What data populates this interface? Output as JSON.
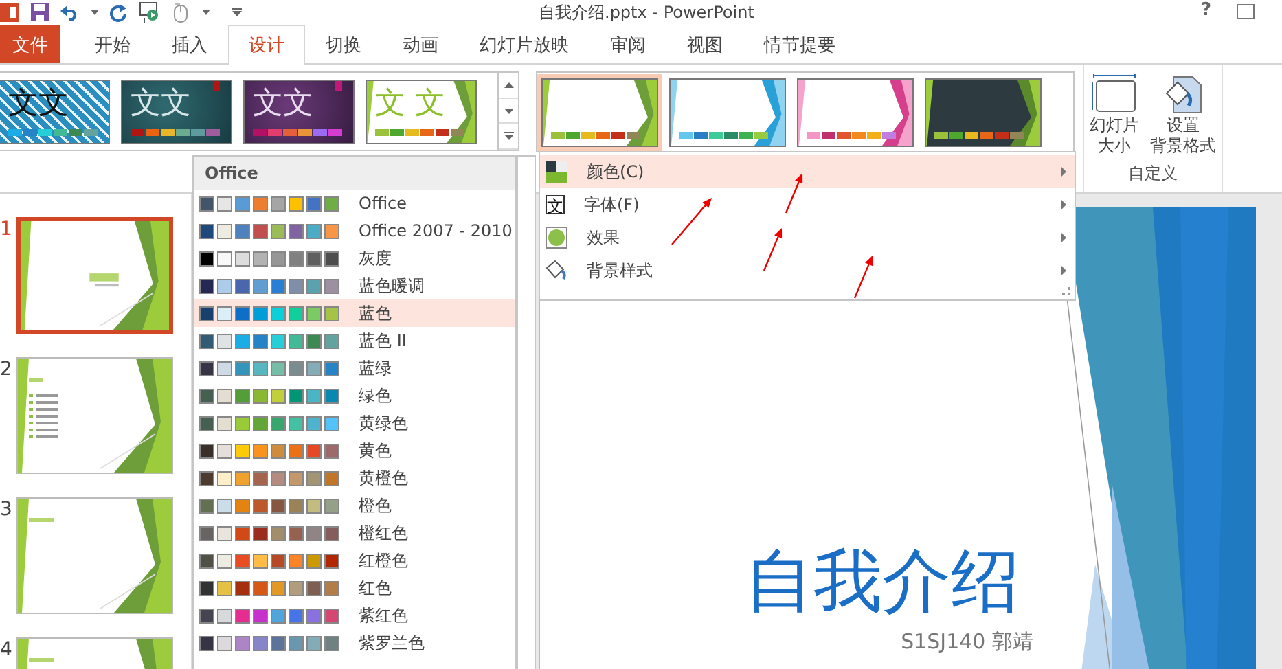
{
  "title_bar": {
    "title": "自我介绍.pptx - PowerPoint",
    "help": "?"
  },
  "tabs": [
    {
      "label": "文件",
      "kind": "file",
      "selected": false
    },
    {
      "label": "开始",
      "kind": "tab",
      "selected": false
    },
    {
      "label": "插入",
      "kind": "tab",
      "selected": false
    },
    {
      "label": "设计",
      "kind": "tab",
      "selected": true
    },
    {
      "label": "切换",
      "kind": "tab",
      "selected": false
    },
    {
      "label": "动画",
      "kind": "tab",
      "selected": false
    },
    {
      "label": "幻灯片放映",
      "kind": "tab",
      "selected": false
    },
    {
      "label": "审阅",
      "kind": "tab",
      "selected": false
    },
    {
      "label": "视图",
      "kind": "tab",
      "selected": false
    },
    {
      "label": "情节提要",
      "kind": "tab",
      "selected": false
    }
  ],
  "themes": [
    {
      "kind": "pattern",
      "sample": "文文",
      "swatches": [
        {
          "color": "#1cade4"
        },
        {
          "color": "#2683c6"
        },
        {
          "color": "#27ced7"
        },
        {
          "color": "#42ba97"
        },
        {
          "color": "#3e8853"
        },
        {
          "color": "#62a39f"
        }
      ]
    },
    {
      "kind": "teal",
      "sample": "文文",
      "swatches": [
        {
          "color": "#b01513"
        },
        {
          "color": "#ea6312"
        },
        {
          "color": "#e6b729"
        },
        {
          "color": "#6aac90"
        },
        {
          "color": "#5f9c9d"
        },
        {
          "color": "#9e5e9b"
        }
      ]
    },
    {
      "kind": "purple",
      "sample": "文文",
      "swatches": [
        {
          "color": "#b31166"
        },
        {
          "color": "#e33d6f"
        },
        {
          "color": "#e45f3c"
        },
        {
          "color": "#e9943a"
        },
        {
          "color": "#9b6bf2"
        },
        {
          "color": "#d53dd0"
        }
      ]
    },
    {
      "kind": "facet",
      "sample": "文 文",
      "swatches": [
        {
          "color": "#99c139"
        },
        {
          "color": "#4ea72e"
        },
        {
          "color": "#e6b91e"
        },
        {
          "color": "#e76618"
        },
        {
          "color": "#c42f1a"
        },
        {
          "color": "#918655"
        }
      ]
    }
  ],
  "variants": [
    {
      "kind": "green",
      "selected": true,
      "swatches": [
        {
          "color": "#99c139"
        },
        {
          "color": "#4ea72e"
        },
        {
          "color": "#e6b91e"
        },
        {
          "color": "#e76618"
        },
        {
          "color": "#c42f1a"
        },
        {
          "color": "#918655"
        }
      ]
    },
    {
      "kind": "blue",
      "selected": false,
      "swatches": [
        {
          "color": "#62c6ef"
        },
        {
          "color": "#2a7fc4"
        },
        {
          "color": "#3dcb9a"
        },
        {
          "color": "#2b8a68"
        },
        {
          "color": "#3cb250"
        },
        {
          "color": "#98cb3e"
        }
      ]
    },
    {
      "kind": "pink",
      "selected": false,
      "swatches": [
        {
          "color": "#f395c5"
        },
        {
          "color": "#c0306e"
        },
        {
          "color": "#e2532e"
        },
        {
          "color": "#f08a1d"
        },
        {
          "color": "#f1b018"
        },
        {
          "color": "#c07ee0"
        }
      ]
    },
    {
      "kind": "dark",
      "selected": false,
      "swatches": [
        {
          "color": "#99c139"
        },
        {
          "color": "#4ea72e"
        },
        {
          "color": "#e6b91e"
        },
        {
          "color": "#e76618"
        },
        {
          "color": "#c42f1a"
        },
        {
          "color": "#918655"
        }
      ]
    }
  ],
  "customize": {
    "buttons": [
      {
        "kind": "size",
        "lines": [
          "幻灯片",
          "大小"
        ]
      },
      {
        "kind": "background",
        "lines": [
          "设置",
          "背景格式"
        ]
      }
    ],
    "group_label": "自定义"
  },
  "slides": [
    {
      "number": "1",
      "selected": true,
      "kind": "title"
    },
    {
      "number": "2",
      "selected": false,
      "kind": "list"
    },
    {
      "number": "3",
      "selected": false,
      "kind": "heading"
    },
    {
      "number": "4",
      "selected": false,
      "kind": "heading"
    }
  ],
  "color_schemes": {
    "header": "Office",
    "items": [
      {
        "name": "Office",
        "selected": false,
        "swatches": [
          {
            "color": "#44546a"
          },
          {
            "color": "#e7e6e6"
          },
          {
            "color": "#5b9bd5"
          },
          {
            "color": "#ed7d31"
          },
          {
            "color": "#a5a5a5"
          },
          {
            "color": "#ffc000"
          },
          {
            "color": "#4472c4"
          },
          {
            "color": "#70ad47"
          }
        ]
      },
      {
        "name": "Office 2007 - 2010",
        "selected": false,
        "swatches": [
          {
            "color": "#1f497d"
          },
          {
            "color": "#eeece1"
          },
          {
            "color": "#4f81bd"
          },
          {
            "color": "#c0504d"
          },
          {
            "color": "#9bbb59"
          },
          {
            "color": "#8064a2"
          },
          {
            "color": "#4bacc6"
          },
          {
            "color": "#f79646"
          }
        ]
      },
      {
        "name": "灰度",
        "selected": false,
        "swatches": [
          {
            "color": "#000000"
          },
          {
            "color": "#f8f8f8"
          },
          {
            "color": "#dddddd"
          },
          {
            "color": "#b2b2b2"
          },
          {
            "color": "#969696"
          },
          {
            "color": "#808080"
          },
          {
            "color": "#5f5f5f"
          },
          {
            "color": "#4d4d4d"
          }
        ]
      },
      {
        "name": "蓝色暖调",
        "selected": false,
        "swatches": [
          {
            "color": "#242852"
          },
          {
            "color": "#acccea"
          },
          {
            "color": "#4a66ac"
          },
          {
            "color": "#629dd1"
          },
          {
            "color": "#297fd5"
          },
          {
            "color": "#7f8fa9"
          },
          {
            "color": "#5aa2ae"
          },
          {
            "color": "#9d90a0"
          }
        ]
      },
      {
        "name": "蓝色",
        "selected": true,
        "swatches": [
          {
            "color": "#17406d"
          },
          {
            "color": "#dbeff9"
          },
          {
            "color": "#0f6fc6"
          },
          {
            "color": "#009dd9"
          },
          {
            "color": "#0bd0d9"
          },
          {
            "color": "#10cf9b"
          },
          {
            "color": "#7cca62"
          },
          {
            "color": "#a5c249"
          }
        ]
      },
      {
        "name": "蓝色 II",
        "selected": false,
        "swatches": [
          {
            "color": "#335b74"
          },
          {
            "color": "#dfe3e5"
          },
          {
            "color": "#1cade4"
          },
          {
            "color": "#2683c6"
          },
          {
            "color": "#27ced7"
          },
          {
            "color": "#42ba97"
          },
          {
            "color": "#3e8853"
          },
          {
            "color": "#62a39f"
          }
        ]
      },
      {
        "name": "蓝绿",
        "selected": false,
        "swatches": [
          {
            "color": "#373545"
          },
          {
            "color": "#cedbe6"
          },
          {
            "color": "#3494ba"
          },
          {
            "color": "#58b6c0"
          },
          {
            "color": "#75bda7"
          },
          {
            "color": "#7a8c8e"
          },
          {
            "color": "#84acb6"
          },
          {
            "color": "#2683c6"
          }
        ]
      },
      {
        "name": "绿色",
        "selected": false,
        "swatches": [
          {
            "color": "#455f51"
          },
          {
            "color": "#e3ded1"
          },
          {
            "color": "#549e39"
          },
          {
            "color": "#8ab833"
          },
          {
            "color": "#c0cf3a"
          },
          {
            "color": "#029676"
          },
          {
            "color": "#4ab5c4"
          },
          {
            "color": "#0989b1"
          }
        ]
      },
      {
        "name": "黄绿色",
        "selected": false,
        "swatches": [
          {
            "color": "#455f51"
          },
          {
            "color": "#e3dfd0"
          },
          {
            "color": "#99cb38"
          },
          {
            "color": "#63a537"
          },
          {
            "color": "#37a76f"
          },
          {
            "color": "#44c1a3"
          },
          {
            "color": "#4eb3cf"
          },
          {
            "color": "#51c3f9"
          }
        ]
      },
      {
        "name": "黄色",
        "selected": false,
        "swatches": [
          {
            "color": "#39302a"
          },
          {
            "color": "#e5dedb"
          },
          {
            "color": "#ffca08"
          },
          {
            "color": "#f8931d"
          },
          {
            "color": "#ce8d3e"
          },
          {
            "color": "#ec7016"
          },
          {
            "color": "#e64823"
          },
          {
            "color": "#9c6a6a"
          }
        ]
      },
      {
        "name": "黄橙色",
        "selected": false,
        "swatches": [
          {
            "color": "#4e3b30"
          },
          {
            "color": "#fbeec9"
          },
          {
            "color": "#f0a22e"
          },
          {
            "color": "#a5644e"
          },
          {
            "color": "#b58b80"
          },
          {
            "color": "#c3986d"
          },
          {
            "color": "#a19574"
          },
          {
            "color": "#c17529"
          }
        ]
      },
      {
        "name": "橙色",
        "selected": false,
        "swatches": [
          {
            "color": "#637052"
          },
          {
            "color": "#ccddea"
          },
          {
            "color": "#e48312"
          },
          {
            "color": "#bd582c"
          },
          {
            "color": "#865640"
          },
          {
            "color": "#9b8357"
          },
          {
            "color": "#c2bc80"
          },
          {
            "color": "#94a088"
          }
        ]
      },
      {
        "name": "橙红色",
        "selected": false,
        "swatches": [
          {
            "color": "#696464"
          },
          {
            "color": "#e9e5dc"
          },
          {
            "color": "#d34817"
          },
          {
            "color": "#9b2d1f"
          },
          {
            "color": "#a28e6a"
          },
          {
            "color": "#956251"
          },
          {
            "color": "#918485"
          },
          {
            "color": "#855d5d"
          }
        ]
      },
      {
        "name": "红橙色",
        "selected": false,
        "swatches": [
          {
            "color": "#505046"
          },
          {
            "color": "#eeece1"
          },
          {
            "color": "#e84c22"
          },
          {
            "color": "#ffbd47"
          },
          {
            "color": "#b64926"
          },
          {
            "color": "#ff8427"
          },
          {
            "color": "#cc9900"
          },
          {
            "color": "#b22600"
          }
        ]
      },
      {
        "name": "红色",
        "selected": false,
        "swatches": [
          {
            "color": "#323232"
          },
          {
            "color": "#e5c243"
          },
          {
            "color": "#a5300f"
          },
          {
            "color": "#d55816"
          },
          {
            "color": "#e19825"
          },
          {
            "color": "#b19c7d"
          },
          {
            "color": "#7f5f52"
          },
          {
            "color": "#b27d49"
          }
        ]
      },
      {
        "name": "紫红色",
        "selected": false,
        "swatches": [
          {
            "color": "#454551"
          },
          {
            "color": "#d8d9dc"
          },
          {
            "color": "#e32d91"
          },
          {
            "color": "#c830cc"
          },
          {
            "color": "#4ea6dc"
          },
          {
            "color": "#4775e7"
          },
          {
            "color": "#8971e1"
          },
          {
            "color": "#d54773"
          }
        ]
      },
      {
        "name": "紫罗兰色",
        "selected": false,
        "swatches": [
          {
            "color": "#373545"
          },
          {
            "color": "#dcd8dc"
          },
          {
            "color": "#ad84c6"
          },
          {
            "color": "#8784c7"
          },
          {
            "color": "#5d739a"
          },
          {
            "color": "#6997af"
          },
          {
            "color": "#84acb6"
          },
          {
            "color": "#6f8183"
          }
        ]
      }
    ]
  },
  "variant_menu": {
    "items": [
      {
        "label": "颜色(C)",
        "kind": "colors",
        "selected": true
      },
      {
        "label": "字体(F)",
        "kind": "fonts",
        "selected": false,
        "glyph": "文"
      },
      {
        "label": "效果",
        "kind": "effects",
        "selected": false
      },
      {
        "label": "背景样式",
        "kind": "background",
        "selected": false
      }
    ]
  },
  "slide": {
    "title": "自我介绍",
    "subtitle": "S1SJ140 郭靖"
  }
}
